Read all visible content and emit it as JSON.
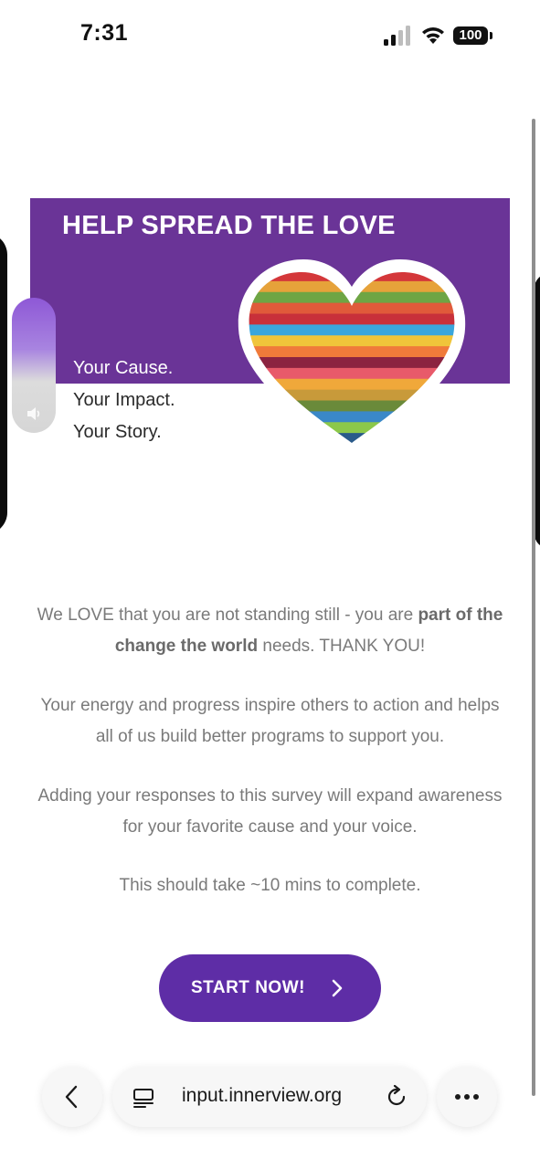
{
  "status_bar": {
    "time": "7:31",
    "battery": "100",
    "icons": [
      "cellular-signal-icon",
      "wifi-icon",
      "battery-icon"
    ]
  },
  "banner": {
    "title": "HELP SPREAD THE LOVE",
    "tagline": [
      "Your Cause.",
      "Your Impact.",
      "Your Story."
    ],
    "background_color": "#6a3497",
    "heart_stripe_colors": [
      "#d4373a",
      "#e6a23a",
      "#6ea544",
      "#e05a3a",
      "#c8303a",
      "#3aa6dc",
      "#f0c53a",
      "#f07a3a",
      "#8c2340",
      "#e85a6a",
      "#f0a83a",
      "#c89a3a",
      "#6a8a3a",
      "#3a88c8",
      "#8cc84a",
      "#2a5a8a"
    ]
  },
  "content": {
    "p1_before": "We LOVE that you are not standing still - you are ",
    "p1_bold": "part of the change the world",
    "p1_after": " needs. THANK YOU!",
    "p2": "Your energy and progress inspire others to action and helps all of us build better programs to support you.",
    "p3": "Adding your responses to this survey will expand awareness for your favorite cause and your voice.",
    "p4": "This should take ~10 mins to complete."
  },
  "cta": {
    "label": "START NOW!",
    "color": "#5e2da6",
    "icon": "chevron-right-icon"
  },
  "browser": {
    "url": "input.innerview.org",
    "icons": [
      "back-chevron-icon",
      "reader-mode-icon",
      "reload-icon",
      "more-icon"
    ]
  }
}
